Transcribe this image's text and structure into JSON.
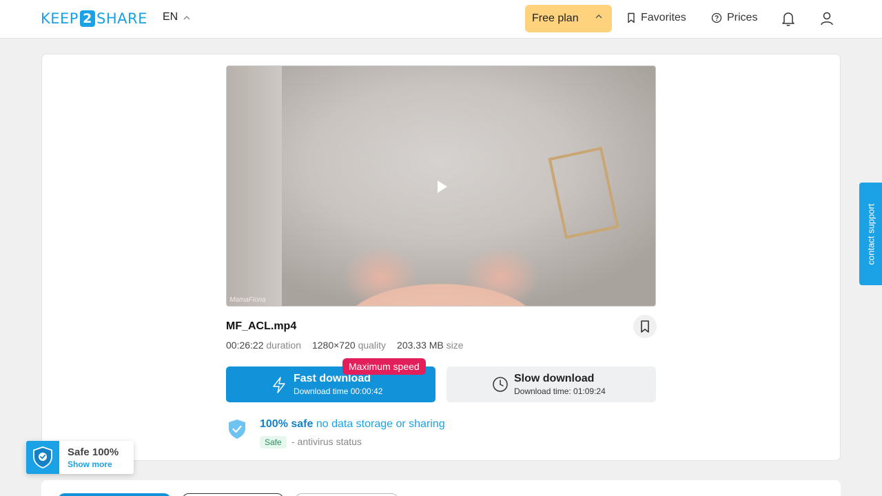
{
  "header": {
    "logo_left": "KEEP",
    "logo_num": "2",
    "logo_right": "SHARE",
    "lang": "EN",
    "plan": "Free plan",
    "favorites": "Favorites",
    "prices": "Prices"
  },
  "file": {
    "name": "MF_ACL.mp4",
    "duration_value": "00:26:22",
    "duration_label": "duration",
    "quality_value": "1280×720",
    "quality_label": "quality",
    "size_value": "203.33 MB",
    "size_label": "size",
    "watermark": "MamaFiona"
  },
  "download": {
    "max_badge": "Maximum speed",
    "fast_title": "Fast download",
    "fast_sub": "Download time 00:00:42",
    "slow_title": "Slow download",
    "slow_sub": "Download time: 01:09:24"
  },
  "safety": {
    "bold": "100% safe",
    "rest": "no data storage or sharing",
    "tag": "Safe",
    "status": "- antivirus status"
  },
  "support": "contact support",
  "popup": {
    "title": "Safe 100%",
    "link": "Show more"
  },
  "colors": {
    "brand": "#1aa1e6",
    "fast": "#1192d9",
    "plan": "#ffd27d",
    "badge": "#e21f5b"
  }
}
